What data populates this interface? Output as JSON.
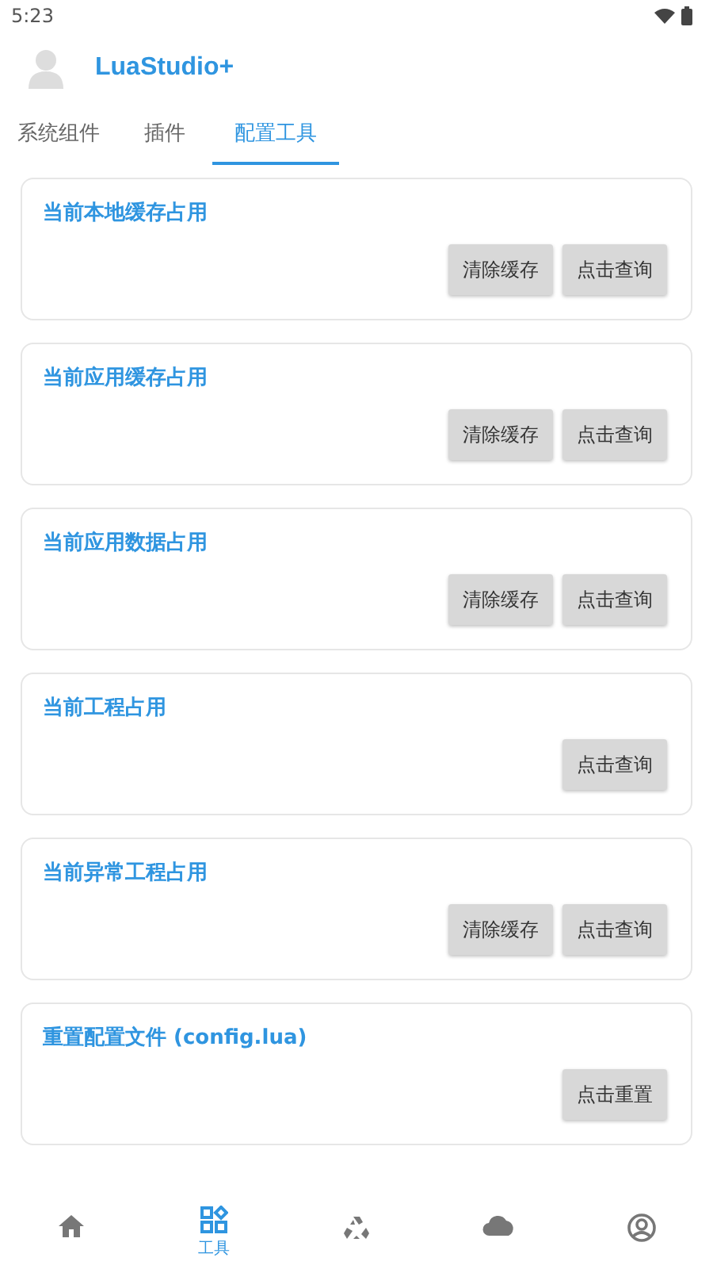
{
  "status_bar": {
    "time": "5:23"
  },
  "header": {
    "title": "LuaStudio+"
  },
  "tabs": [
    {
      "label": "系统组件",
      "selected": false
    },
    {
      "label": "插件",
      "selected": false
    },
    {
      "label": "配置工具",
      "selected": true
    }
  ],
  "cards": [
    {
      "title": "当前本地缓存占用",
      "buttons": [
        "清除缓存",
        "点击查询"
      ]
    },
    {
      "title": "当前应用缓存占用",
      "buttons": [
        "清除缓存",
        "点击查询"
      ]
    },
    {
      "title": "当前应用数据占用",
      "buttons": [
        "清除缓存",
        "点击查询"
      ]
    },
    {
      "title": "当前工程占用",
      "buttons": [
        "点击查询"
      ]
    },
    {
      "title": "当前异常工程占用",
      "buttons": [
        "清除缓存",
        "点击查询"
      ]
    },
    {
      "title": "重置配置文件 (config.lua)",
      "buttons": [
        "点击重置"
      ]
    }
  ],
  "bottom_nav": [
    {
      "kind": "home",
      "selected": false
    },
    {
      "kind": "tools",
      "label": "工具",
      "selected": true
    },
    {
      "kind": "recycle",
      "selected": false
    },
    {
      "kind": "cloud",
      "selected": false
    },
    {
      "kind": "account",
      "selected": false
    }
  ]
}
